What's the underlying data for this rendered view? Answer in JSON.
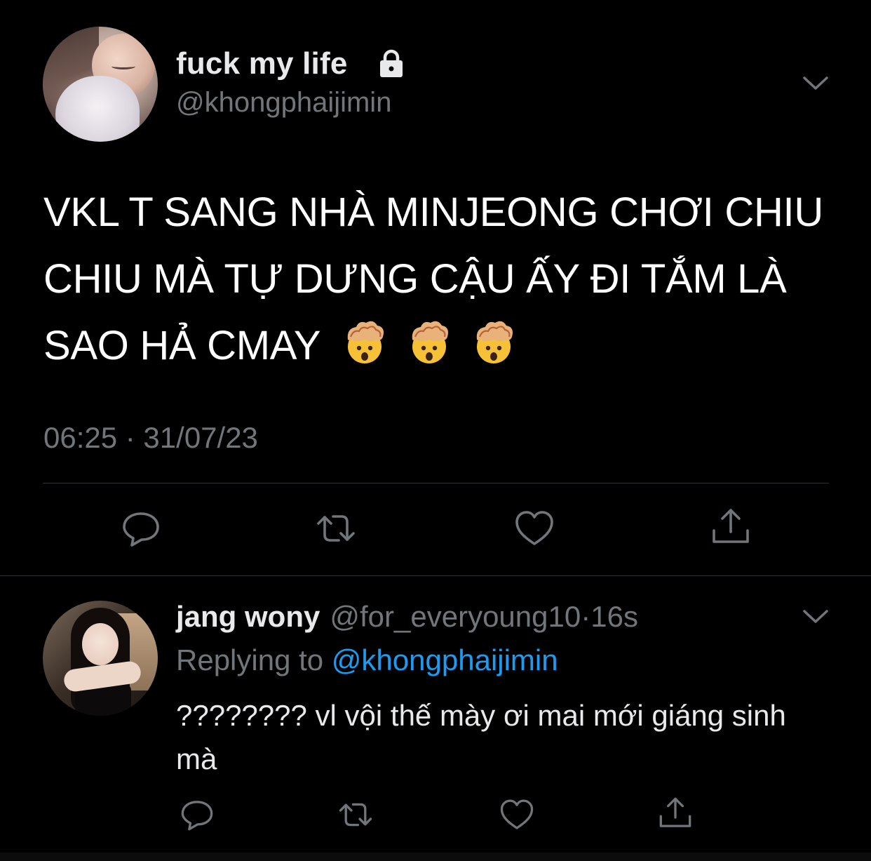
{
  "main_tweet": {
    "display_name": "fuck my life",
    "handle": "@khongphaijimin",
    "text": "VKL T SANG NHÀ MINJEONG CHƠI CHIU CHIU MÀ TỰ DƯNG CẬU ẤY ĐI TẮM LÀ SAO HẢ CMAY",
    "emojis": [
      "exploding-head",
      "exploding-head",
      "exploding-head"
    ],
    "timestamp": "06:25 · 31/07/23",
    "protected": true
  },
  "reply_tweet": {
    "display_name": "jang wony",
    "handle": "@for_everyoung10",
    "separator": "·",
    "time_ago": "16s",
    "replying_prefix": "Replying to ",
    "replying_mention": "@khongphaijimin",
    "text": "???????? vl vội thế mày ơi mai mới giáng sinh mà"
  },
  "icons": {
    "lock": "lock-icon",
    "chevron": "chevron-down-icon",
    "reply": "reply-icon",
    "retweet": "retweet-icon",
    "like": "heart-icon",
    "share": "share-icon"
  },
  "colors": {
    "background": "#000000",
    "primary_text": "#e7e9ea",
    "secondary_text": "#71767b",
    "link": "#1d9bf0",
    "divider": "#2f3336"
  }
}
